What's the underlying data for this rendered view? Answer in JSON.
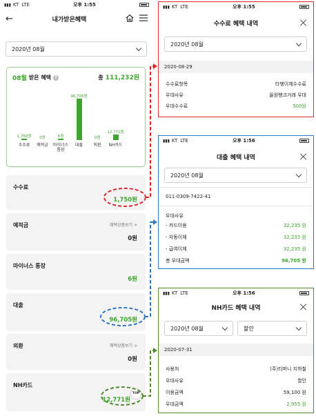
{
  "left": {
    "status": {
      "carrier": "KT",
      "network": "LTE",
      "time": "오후 1:55"
    },
    "header": {
      "title": "내가받은혜택",
      "back_icon": "back-arrow-icon",
      "home_icon": "home-icon",
      "menu_icon": "hamburger-icon"
    },
    "month_select": "2020년 08월",
    "summary": {
      "month": "08월",
      "label": "받은 혜택",
      "total_prefix": "총",
      "total": "111,232원"
    },
    "chart_data": {
      "type": "bar",
      "categories": [
        "수수료",
        "예적금",
        "마이너스\n통장",
        "대출",
        "외환",
        "NH카드"
      ],
      "values": [
        1750,
        0,
        6,
        96705,
        0,
        12771
      ],
      "value_labels": [
        "1,750원",
        "0원",
        "6원",
        "96,705원",
        "0원",
        "12,771원"
      ],
      "color": "#3ea52f"
    },
    "categories": [
      {
        "label": "수수료",
        "amount": "1,750원",
        "link": ""
      },
      {
        "label": "예적금",
        "amount": "0원",
        "link": "혜택상품보기 >"
      },
      {
        "label": "마이너스 통장",
        "amount": "6원",
        "link": ""
      },
      {
        "label": "대출",
        "amount": "96,705원",
        "link": ""
      },
      {
        "label": "외환",
        "amount": "0원",
        "link": "혜택상품보기 >"
      },
      {
        "label": "NH카드",
        "amount": "12,771원",
        "link": ""
      }
    ],
    "top_button": "TOP"
  },
  "fee_panel": {
    "status": {
      "carrier": "KT",
      "network": "LTE",
      "time": "오후 1:55"
    },
    "title": "수수료 혜택 내역",
    "month_select": "2020년 08월",
    "date": "2020-08-29",
    "rows": [
      {
        "k": "수수료항목",
        "v": "타행이체수수료"
      },
      {
        "k": "우대사유",
        "v": "올원뱅크거래 우대"
      },
      {
        "k": "우대수수료",
        "v": "500원"
      }
    ],
    "border_color": "#e0262b"
  },
  "loan_panel": {
    "status": {
      "carrier": "KT",
      "network": "LTE",
      "time": "오후 1:56"
    },
    "title": "대출 혜택 내역",
    "month_select": "2020년 08월",
    "account": "011-0309-7422-41",
    "reason_label": "우대사유",
    "rows": [
      {
        "k": "- 카드이용",
        "v": "32,235 원"
      },
      {
        "k": "- 자동이체",
        "v": "32,235 원"
      },
      {
        "k": "- 급여이체",
        "v": "32,235 원"
      },
      {
        "k": "총 우대금액",
        "v": "96,705 원"
      }
    ],
    "border_color": "#2f78bf"
  },
  "card_panel": {
    "status": {
      "carrier": "KT",
      "network": "LTE",
      "time": "오후 1:56"
    },
    "title": "NH카드 혜택 내역",
    "month_select": "2020년 08월",
    "type_select": "할인",
    "date": "2020-07-31",
    "rows": [
      {
        "k": "사용처",
        "v": "(주)티머니 지하철"
      },
      {
        "k": "우대사유",
        "v": "할인"
      },
      {
        "k": "이용금액",
        "v": "59,100 원"
      },
      {
        "k": "우대금액",
        "v": "2,955 원"
      }
    ],
    "border_color": "#4e8a2f"
  }
}
